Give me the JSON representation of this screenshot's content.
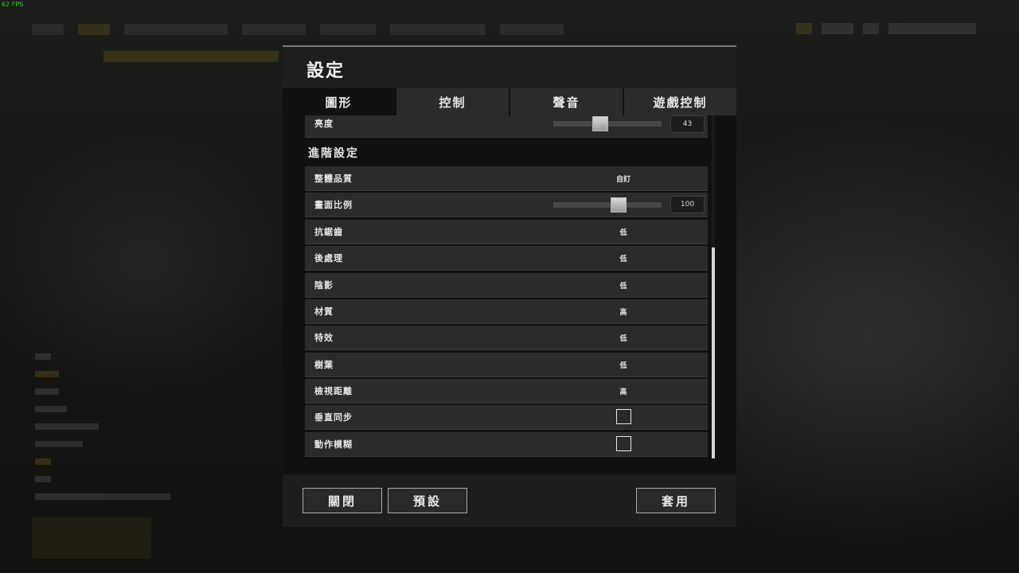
{
  "overlay": {
    "fps": "62 FPS"
  },
  "dialog": {
    "title": "設定"
  },
  "tabs": [
    {
      "label": "圖形",
      "active": true
    },
    {
      "label": "控制",
      "active": false
    },
    {
      "label": "聲音",
      "active": false
    },
    {
      "label": "遊戲控制",
      "active": false
    }
  ],
  "basic": {
    "brightness": {
      "label": "亮度",
      "value": "43",
      "level": 43
    }
  },
  "advanced": {
    "section_title": "進階設定",
    "overall_quality": {
      "label": "整體品質",
      "value": "自訂"
    },
    "screen_scale": {
      "label": "畫面比例",
      "value": "100",
      "level": 100
    },
    "anti_aliasing": {
      "label": "抗鋸齒",
      "value": "低"
    },
    "post_processing": {
      "label": "後處理",
      "value": "低"
    },
    "shadows": {
      "label": "陰影",
      "value": "低"
    },
    "textures": {
      "label": "材質",
      "value": "高"
    },
    "effects": {
      "label": "特效",
      "value": "低"
    },
    "foliage": {
      "label": "樹葉",
      "value": "低"
    },
    "view_distance": {
      "label": "檢視距離",
      "value": "高"
    },
    "vsync": {
      "label": "垂直同步",
      "checked": false
    },
    "motion_blur": {
      "label": "動作模糊",
      "checked": false
    }
  },
  "footer": {
    "close_label": "關閉",
    "default_label": "預設",
    "apply_label": "套用"
  }
}
